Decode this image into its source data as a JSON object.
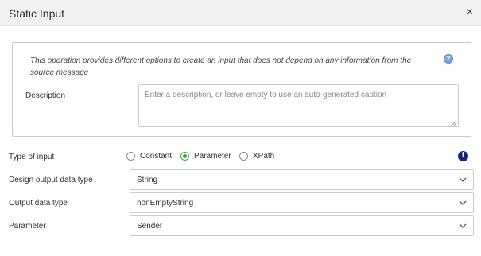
{
  "dialog": {
    "title": "Static Input",
    "close_glyph": "×"
  },
  "panel": {
    "info_text": "This operation provides different options to create an input that does not depend on any information from the source message",
    "help_glyph": "?",
    "description_label": "Description",
    "description_placeholder": "Enter a description, or leave empty to use an auto-generated caption",
    "description_value": ""
  },
  "form": {
    "type_of_input": {
      "label": "Type of input",
      "options": [
        "Constant",
        "Parameter",
        "XPath"
      ],
      "selected": "Parameter",
      "info_glyph": "i"
    },
    "design_output_data_type": {
      "label": "Design output data type",
      "value": "String"
    },
    "output_data_type": {
      "label": "Output data type",
      "value": "nonEmptyString"
    },
    "parameter": {
      "label": "Parameter",
      "value": "Sender"
    }
  },
  "colors": {
    "radio_selected": "#3aa33a",
    "info_icon": "#1a237e",
    "help_icon": "#7fa9d4",
    "header_bg": "#f2f2f2"
  },
  "icons": {
    "close": "close-icon",
    "help": "help-icon",
    "info": "info-icon",
    "dropdown": "chevron-down-icon"
  }
}
